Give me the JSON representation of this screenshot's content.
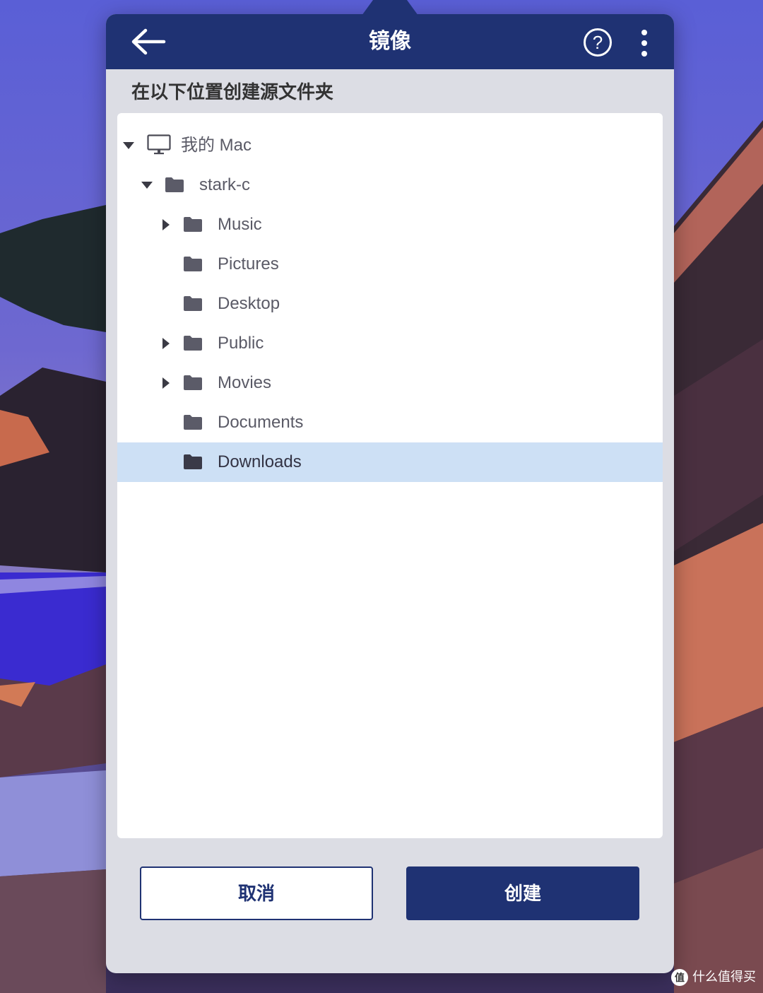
{
  "header": {
    "title": "镜像",
    "help_label": "?"
  },
  "subtitle": "在以下位置创建源文件夹",
  "tree": {
    "items": [
      {
        "label": "我的 Mac",
        "indent": 0,
        "expanded": true,
        "has_children": true,
        "icon": "computer-icon",
        "selected": false
      },
      {
        "label": "stark-c",
        "indent": 1,
        "expanded": true,
        "has_children": true,
        "icon": "folder-icon",
        "selected": false
      },
      {
        "label": "Music",
        "indent": 2,
        "expanded": false,
        "has_children": true,
        "icon": "folder-icon",
        "selected": false
      },
      {
        "label": "Pictures",
        "indent": 2,
        "expanded": false,
        "has_children": false,
        "icon": "folder-icon",
        "selected": false
      },
      {
        "label": "Desktop",
        "indent": 2,
        "expanded": false,
        "has_children": false,
        "icon": "folder-icon",
        "selected": false
      },
      {
        "label": "Public",
        "indent": 2,
        "expanded": false,
        "has_children": true,
        "icon": "folder-icon",
        "selected": false
      },
      {
        "label": "Movies",
        "indent": 2,
        "expanded": false,
        "has_children": true,
        "icon": "folder-icon",
        "selected": false
      },
      {
        "label": "Documents",
        "indent": 2,
        "expanded": false,
        "has_children": false,
        "icon": "folder-icon",
        "selected": false
      },
      {
        "label": "Downloads",
        "indent": 2,
        "expanded": false,
        "has_children": false,
        "icon": "folder-icon",
        "selected": true
      }
    ]
  },
  "buttons": {
    "cancel_label": "取消",
    "create_label": "创建"
  },
  "watermark": {
    "logo": "值",
    "text": "什么值得买"
  },
  "colors": {
    "header_bg": "#1f3273",
    "selected_row": "#cde0f5",
    "panel_bg": "#dcdde4"
  }
}
